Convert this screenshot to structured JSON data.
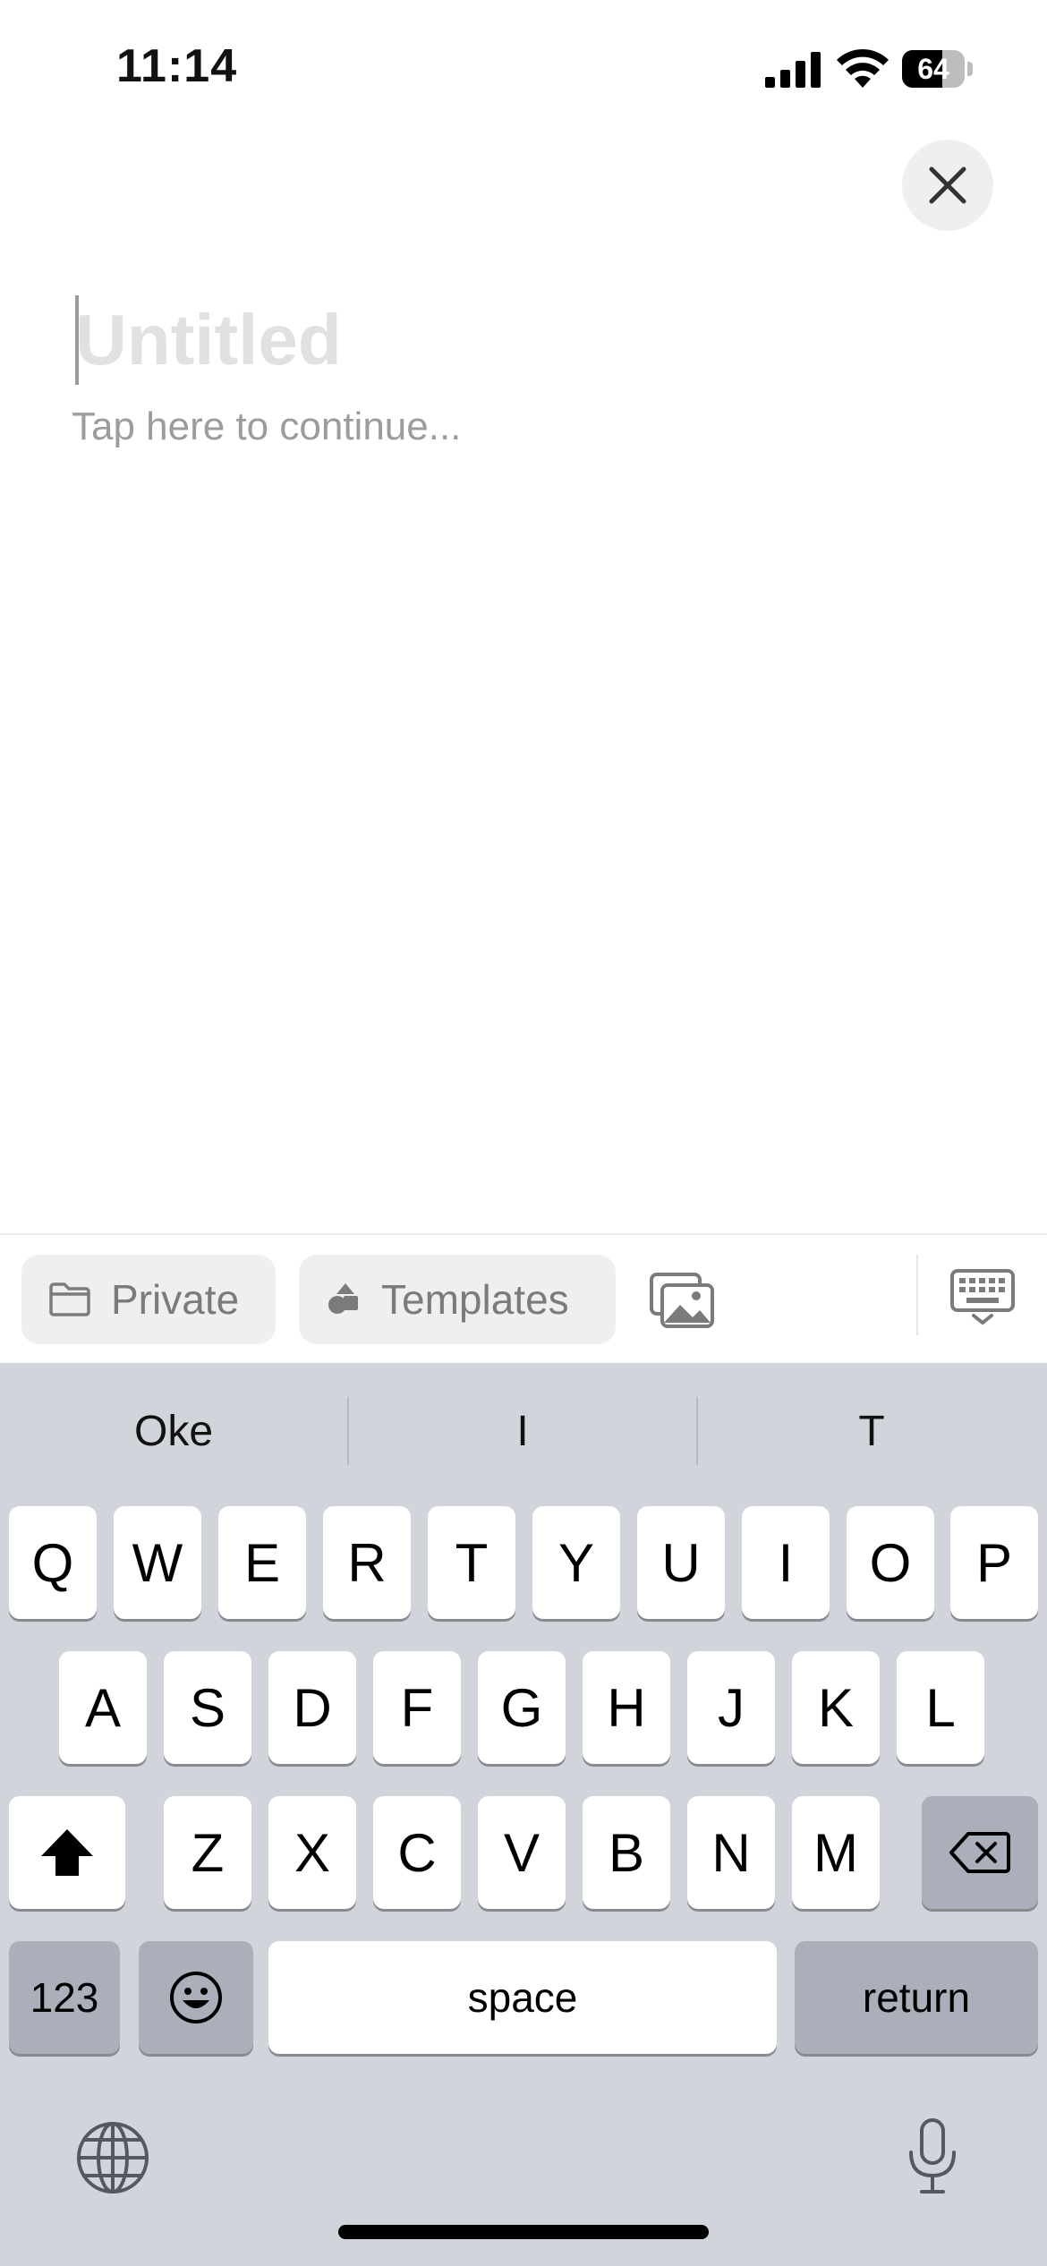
{
  "status_bar": {
    "time": "11:14",
    "battery_percent": "64",
    "battery_level": 0.64
  },
  "editor": {
    "title_placeholder": "Untitled",
    "body_placeholder": "Tap here to continue..."
  },
  "toolbar": {
    "private_label": "Private",
    "templates_label": "Templates"
  },
  "keyboard": {
    "suggestions": [
      "Oke",
      "I",
      "T"
    ],
    "row1": [
      "Q",
      "W",
      "E",
      "R",
      "T",
      "Y",
      "U",
      "I",
      "O",
      "P"
    ],
    "row2": [
      "A",
      "S",
      "D",
      "F",
      "G",
      "H",
      "J",
      "K",
      "L"
    ],
    "row3": [
      "Z",
      "X",
      "C",
      "V",
      "B",
      "N",
      "M"
    ],
    "numbers_label": "123",
    "space_label": "space",
    "return_label": "return"
  },
  "icons": {
    "close": "close-icon",
    "folder": "folder-icon",
    "templates": "shapes-icon",
    "media": "photos-icon",
    "keyboard": "keyboard-dismiss-icon",
    "shift": "shift-icon",
    "delete": "backspace-icon",
    "emoji": "emoji-icon",
    "globe": "globe-icon",
    "mic": "microphone-icon"
  }
}
